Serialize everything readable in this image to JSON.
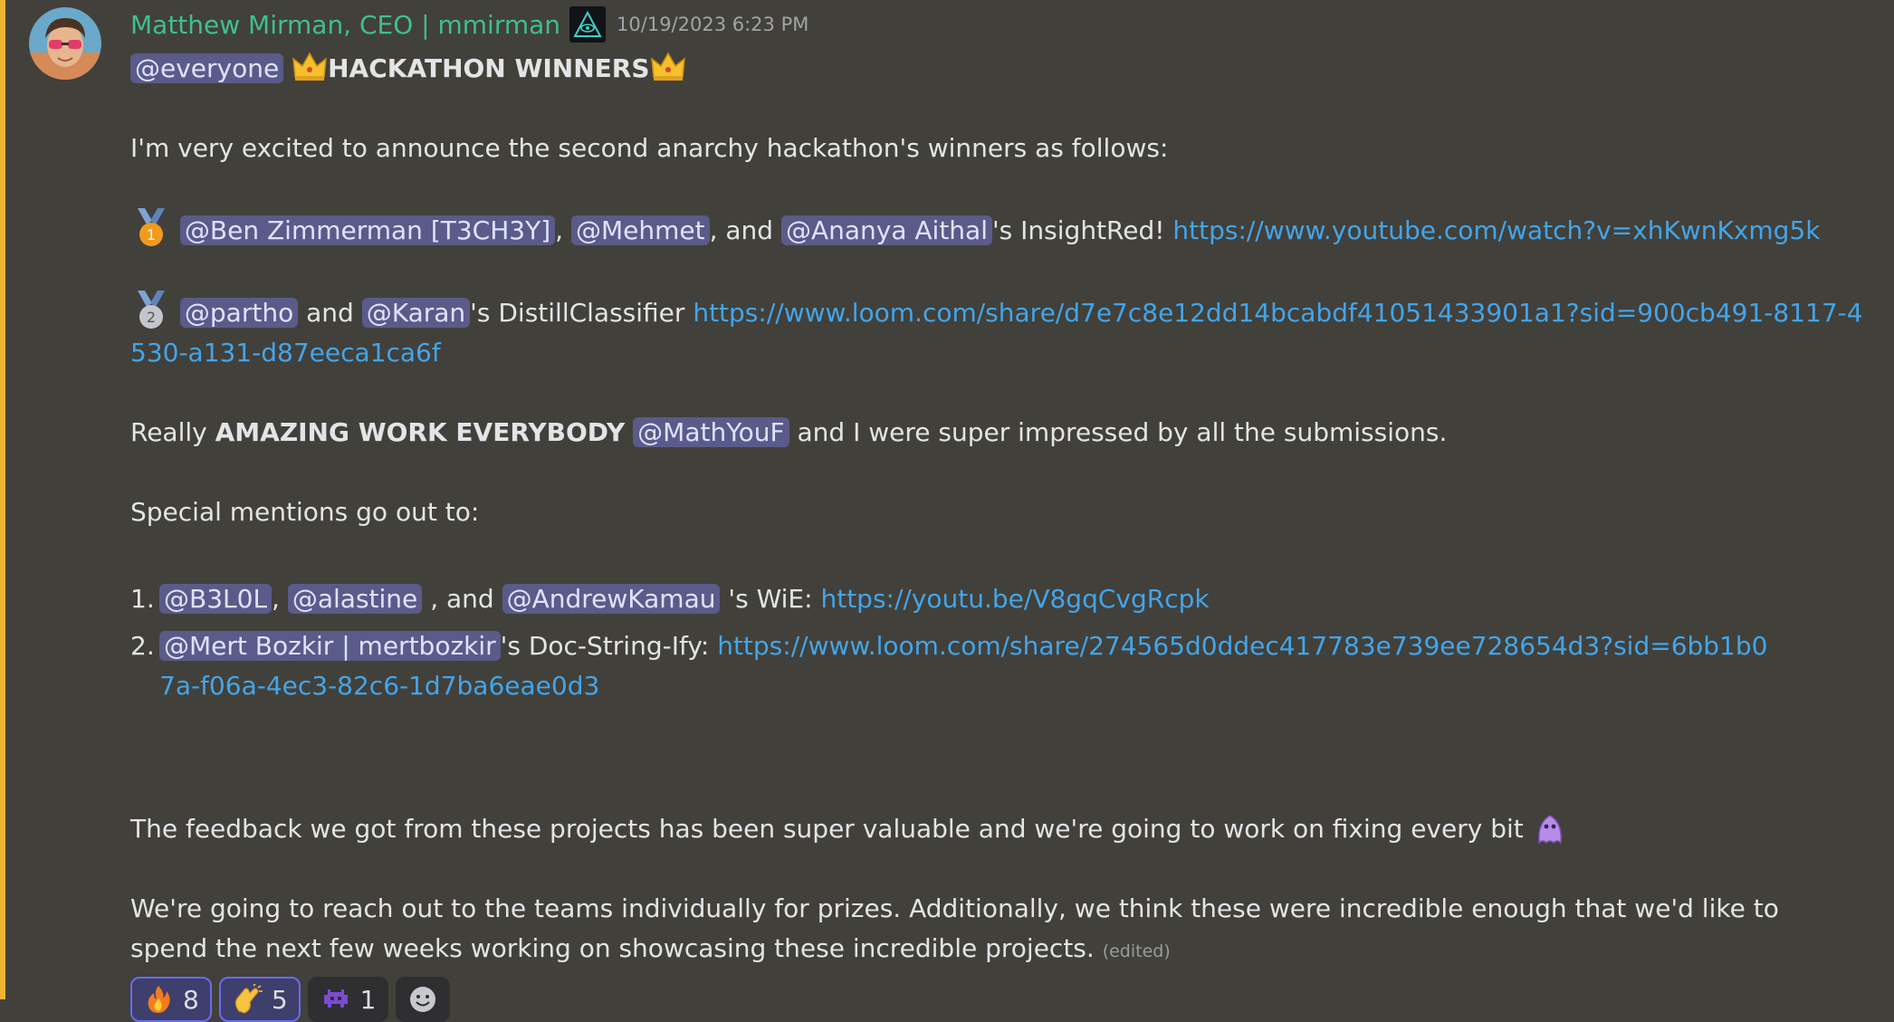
{
  "message": {
    "author": "Matthew Mirman, CEO | mmirman",
    "timestamp": "10/19/2023 6:23 PM",
    "role_icon": "illuminati-eye-icon",
    "accent_color": "#f0b232",
    "mention_everyone": "@everyone",
    "title": "HACKATHON WINNERS",
    "intro": "I'm very excited to announce the second anarchy hackathon's winners as follows:",
    "first_place": {
      "mention1": "@Ben Zimmerman [T3CH3Y]",
      "sep1": ",",
      "mention2": "@Mehmet",
      "sep2": ", and",
      "mention3": "@Ananya Aithal",
      "project": "'s InsightRed!",
      "link": "https://www.youtube.com/watch?v=xhKwnKxmg5k"
    },
    "second_place": {
      "mention1": "@partho",
      "sep1": "and",
      "mention2": "@Karan",
      "project": "'s  DistillClassifier",
      "link": "https://www.loom.com/share/d7e7c8e12dd14bcabdf41051433901a1?sid=900cb491-8117-4530-a131-d87eeca1ca6f"
    },
    "amazing": {
      "pre": "Really",
      "bold": "AMAZING WORK EVERYBODY",
      "mention": "@MathYouF",
      "post": "and I were super impressed by all the submissions."
    },
    "special_heading": "Special mentions go out to:",
    "special_list": {
      "item1": {
        "num": "1.",
        "mention1": "@B3L0L",
        "sep1": ",",
        "mention2": "@alastine",
        "sep2": ", and",
        "mention3": "@AndrewKamau",
        "project": "'s WiE:",
        "link": "https://youtu.be/V8gqCvgRcpk"
      },
      "item2": {
        "num": "2.",
        "mention1": "@Mert Bozkir | mertbozkir",
        "project": "'s Doc-String-Ify:",
        "link": "https://www.loom.com/share/274565d0ddec417783e739ee728654d3?sid=6bb1b07a-f06a-4ec3-82c6-1d7ba6eae0d3"
      }
    },
    "feedback": "The feedback we got from these projects has been super valuable and we're going to work on fixing every bit",
    "closing": "We're going to reach out to the teams individually for prizes. Additionally, we think these were incredible enough that we'd like to spend the next few weeks working on showcasing these incredible projects.",
    "edited_label": "(edited)"
  },
  "reactions": [
    {
      "icon": "fire-icon",
      "count": "8",
      "reacted": true
    },
    {
      "icon": "clapping-hands-icon",
      "count": "5",
      "reacted": true
    },
    {
      "icon": "space-invader-icon",
      "count": "1",
      "reacted": false
    }
  ],
  "add_reaction_icon": "smiley-icon"
}
